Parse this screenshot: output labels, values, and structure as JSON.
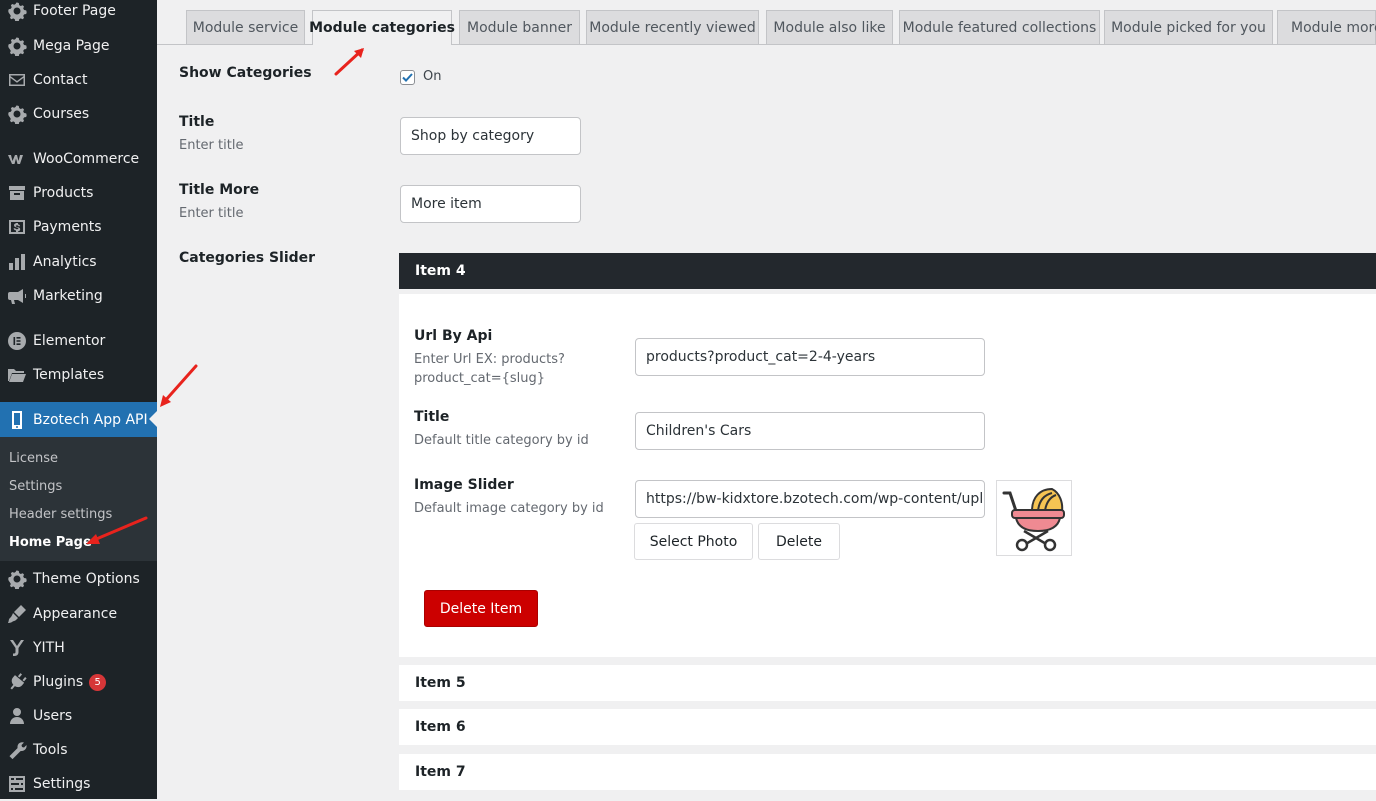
{
  "sidebar": {
    "items": [
      {
        "label": "Footer Page",
        "icon": "gear-icon"
      },
      {
        "label": "Mega Page",
        "icon": "gear-icon"
      },
      {
        "label": "Contact",
        "icon": "envelope-icon"
      },
      {
        "label": "Courses",
        "icon": "gear-icon"
      },
      {
        "label": "WooCommerce",
        "icon": "woocommerce-icon"
      },
      {
        "label": "Products",
        "icon": "archive-icon"
      },
      {
        "label": "Payments",
        "icon": "dollar-icon"
      },
      {
        "label": "Analytics",
        "icon": "bar-chart-icon"
      },
      {
        "label": "Marketing",
        "icon": "megaphone-icon"
      },
      {
        "label": "Elementor",
        "icon": "elementor-icon"
      },
      {
        "label": "Templates",
        "icon": "folder-icon"
      },
      {
        "label": "Bzotech App API",
        "icon": "phone-icon"
      },
      {
        "label": "Theme Options",
        "icon": "gear-icon"
      },
      {
        "label": "Appearance",
        "icon": "brush-icon"
      },
      {
        "label": "YITH",
        "icon": "yith-icon"
      },
      {
        "label": "Plugins",
        "icon": "plug-icon",
        "badge": "5"
      },
      {
        "label": "Users",
        "icon": "user-icon"
      },
      {
        "label": "Tools",
        "icon": "wrench-icon"
      },
      {
        "label": "Settings",
        "icon": "sliders-icon"
      }
    ],
    "submenu": [
      "License",
      "Settings",
      "Header settings",
      "Home Page"
    ],
    "current_submenu": "Home Page"
  },
  "tabs": [
    "Module service",
    "Module categories",
    "Module banner",
    "Module recently viewed",
    "Module also like",
    "Module featured collections",
    "Module picked for you",
    "Module more"
  ],
  "active_tab": "Module categories",
  "form": {
    "show_categories": {
      "label": "Show Categories",
      "checked": true,
      "checkbox_label": "On"
    },
    "title": {
      "label": "Title",
      "desc": "Enter title",
      "value": "Shop by category"
    },
    "title_more": {
      "label": "Title More",
      "desc": "Enter title",
      "value": "More item"
    },
    "slider": {
      "label": "Categories Slider"
    }
  },
  "item4": {
    "header": "Item 4",
    "url": {
      "label": "Url By Api",
      "desc_line1": "Enter Url EX: products?",
      "desc_line2": "product_cat={slug}",
      "value": "products?product_cat=2-4-years"
    },
    "title": {
      "label": "Title",
      "desc": "Default title category by id",
      "value": "Children's Cars"
    },
    "image": {
      "label": "Image Slider",
      "desc": "Default image category by id",
      "value": "https://bw-kidxtore.bzotech.com/wp-content/upload",
      "select": "Select Photo",
      "delete": "Delete"
    },
    "delete_item": "Delete Item"
  },
  "other_items": [
    "Item 5",
    "Item 6",
    "Item 7"
  ],
  "colors": {
    "sidebar": "#1d2327",
    "active": "#2271b1",
    "danger": "#cc0000",
    "annotation": "#e8231d"
  }
}
